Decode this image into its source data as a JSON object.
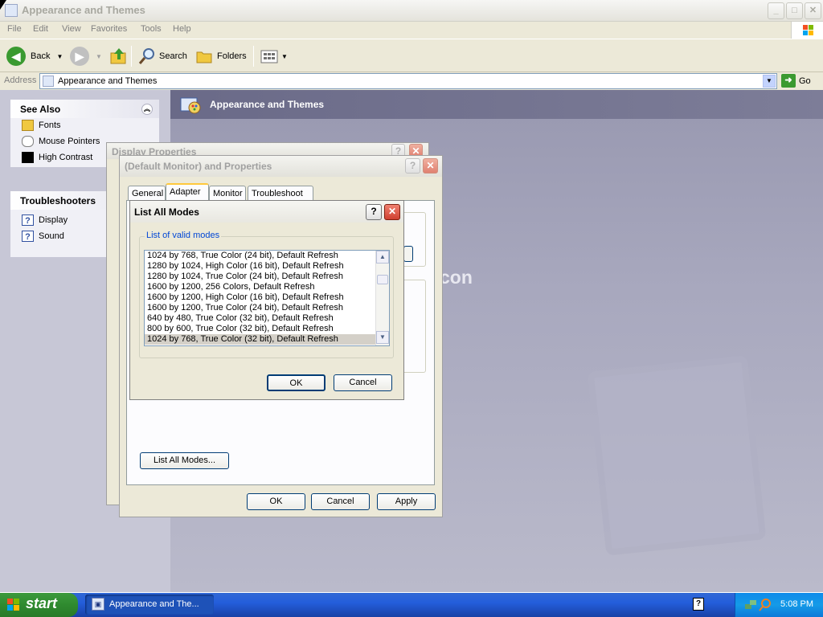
{
  "window": {
    "title": "Appearance and Themes",
    "minimize": "_",
    "maximize": "□",
    "close": "✕"
  },
  "menu": [
    "File",
    "Edit",
    "View",
    "Favorites",
    "Tools",
    "Help"
  ],
  "toolbar": {
    "back": "Back",
    "search": "Search",
    "folders": "Folders"
  },
  "address": {
    "label": "Address",
    "value": "Appearance and Themes",
    "go": "Go"
  },
  "see_also": {
    "title": "See Also",
    "items": [
      {
        "label": "Fonts",
        "icon": "folder-fonts-icon"
      },
      {
        "label": "Mouse Pointers",
        "icon": "mouse-icon"
      },
      {
        "label": "High Contrast",
        "icon": "contrast-icon"
      }
    ]
  },
  "troubleshooters": {
    "title": "Troubleshooters",
    "items": [
      {
        "label": "Display",
        "icon": "help-icon"
      },
      {
        "label": "Sound",
        "icon": "help-icon"
      }
    ]
  },
  "main": {
    "title": "Appearance and Themes",
    "partial_text": "con"
  },
  "display_properties": {
    "title": "Display Properties"
  },
  "monitor_props": {
    "title": "(Default Monitor) and  Properties",
    "tabs": [
      "General",
      "Adapter",
      "Monitor",
      "Troubleshoot"
    ],
    "active_tab": "Adapter",
    "list_all_modes": "List All Modes...",
    "ok": "OK",
    "cancel": "Cancel",
    "apply": "Apply"
  },
  "list_modes": {
    "title": "List All Modes",
    "group_label": "List of valid modes",
    "modes": [
      "1024 by 768, True Color (24 bit), Default Refresh",
      "1280 by 1024, High Color (16 bit), Default Refresh",
      "1280 by 1024, True Color (24 bit), Default Refresh",
      "1600 by 1200, 256 Colors, Default Refresh",
      "1600 by 1200, High Color (16 bit), Default Refresh",
      "1600 by 1200, True Color (24 bit), Default Refresh",
      "640 by 480, True Color (32 bit), Default Refresh",
      "800 by 600, True Color (32 bit), Default Refresh",
      "1024 by 768, True Color (32 bit), Default Refresh"
    ],
    "selected_index": 8,
    "ok": "OK",
    "cancel": "Cancel"
  },
  "taskbar": {
    "start": "start",
    "task": "Appearance and The...",
    "clock": "5:08 PM"
  }
}
